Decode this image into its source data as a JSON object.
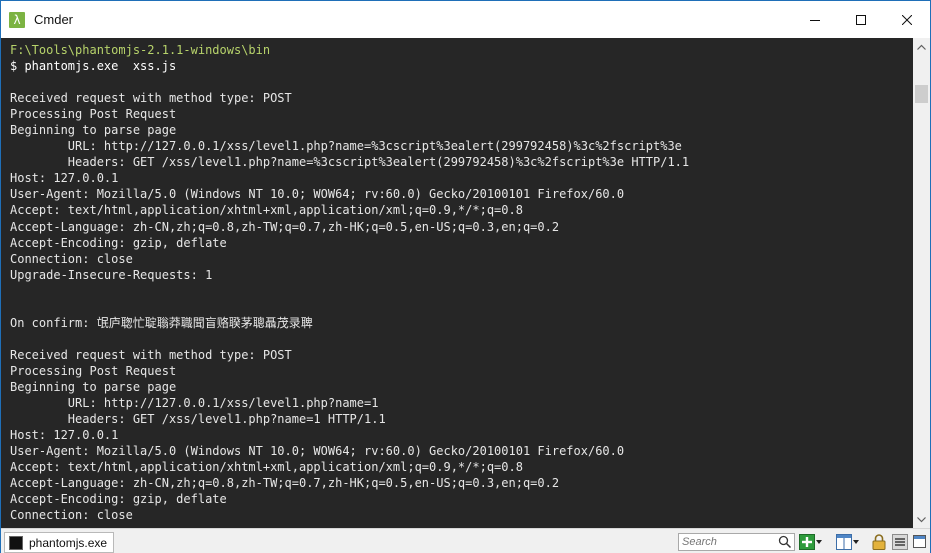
{
  "window": {
    "title": "Cmder",
    "app_icon": "λ",
    "accent": "#1f6fb8"
  },
  "terminal": {
    "lines": [
      "F:\\Tools\\phantomjs-2.1.1-windows\\bin",
      "$ phantomjs.exe  xss.js",
      "",
      "Received request with method type: POST",
      "Processing Post Request",
      "Beginning to parse page",
      "        URL: http://127.0.0.1/xss/level1.php?name=%3cscript%3ealert(299792458)%3c%2fscript%3e",
      "        Headers: GET /xss/level1.php?name=%3cscript%3ealert(299792458)%3c%2fscript%3e HTTP/1.1",
      "Host: 127.0.0.1",
      "User-Agent: Mozilla/5.0 (Windows NT 10.0; WOW64; rv:60.0) Gecko/20100101 Firefox/60.0",
      "Accept: text/html,application/xhtml+xml,application/xml;q=0.9,*/*;q=0.8",
      "Accept-Language: zh-CN,zh;q=0.8,zh-TW;q=0.7,zh-HK;q=0.5,en-US;q=0.3,en;q=0.2",
      "Accept-Encoding: gzip, deflate",
      "Connection: close",
      "Upgrade-Insecure-Requests: 1",
      "",
      "",
      "On confirm: 氓庐聦忙聢聬莽職聞盲赂聧茅聰聶茂录聛",
      "",
      "Received request with method type: POST",
      "Processing Post Request",
      "Beginning to parse page",
      "        URL: http://127.0.0.1/xss/level1.php?name=1",
      "        Headers: GET /xss/level1.php?name=1 HTTP/1.1",
      "Host: 127.0.0.1",
      "User-Agent: Mozilla/5.0 (Windows NT 10.0; WOW64; rv:60.0) Gecko/20100101 Firefox/60.0",
      "Accept: text/html,application/xhtml+xml,application/xml;q=0.9,*/*;q=0.8",
      "Accept-Language: zh-CN,zh;q=0.8,zh-TW;q=0.7,zh-HK;q=0.5,en-US;q=0.3,en;q=0.2",
      "Accept-Encoding: gzip, deflate",
      "Connection: close"
    ],
    "path_color": "#b7d36b",
    "text_color": "#e6e6e6",
    "background": "#262626"
  },
  "statusbar": {
    "tab_label": "phantomjs.exe",
    "search_placeholder": "Search",
    "icons": [
      "search-icon",
      "new-console-icon",
      "split-view-icon",
      "lock-icon",
      "menu-icon"
    ]
  }
}
